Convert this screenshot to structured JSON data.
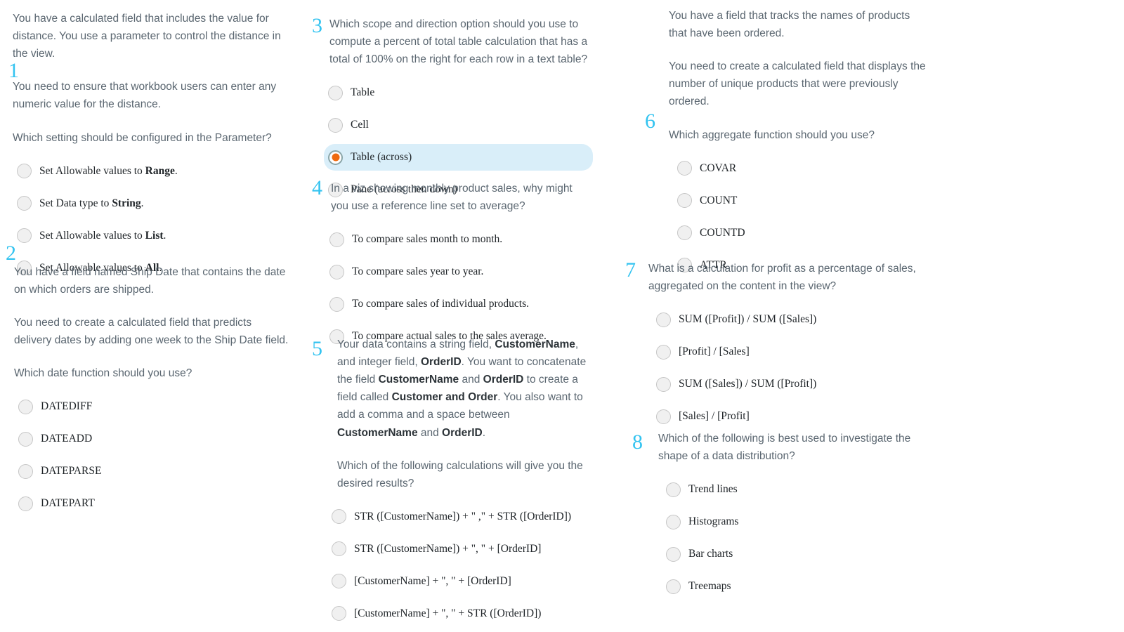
{
  "accent": {
    "number_color": "#33c3f0",
    "selected_row_bg": "#d9eef9",
    "selected_radio_dot": "#ef6a10",
    "stem_text": "#5a6670",
    "option_text": "#202529"
  },
  "questions": [
    {
      "number": "1",
      "stem_paragraphs": [
        "You have a calculated field that includes the value for distance. You use a parameter to control the distance in the view.",
        "You need to ensure that workbook users can enter any numeric value for the distance.",
        "Which setting should be configured in the Parameter?"
      ],
      "options": [
        {
          "prefix": "Set Allowable values to ",
          "bold": "Range",
          "suffix": "."
        },
        {
          "prefix": "Set Data type to ",
          "bold": "String",
          "suffix": "."
        },
        {
          "prefix": "Set Allowable values to ",
          "bold": "List",
          "suffix": "."
        },
        {
          "prefix": "Set Allowable values to ",
          "bold": "All",
          "suffix": "."
        }
      ],
      "selected_index": -1
    },
    {
      "number": "2",
      "stem_paragraphs": [
        "You have a field named Ship Date that contains the date on which orders are shipped.",
        "You need to create a calculated field that predicts delivery dates by adding one week to the Ship Date field.",
        "Which date function should you use?"
      ],
      "options": [
        {
          "prefix": "DATEDIFF",
          "bold": "",
          "suffix": ""
        },
        {
          "prefix": "DATEADD",
          "bold": "",
          "suffix": ""
        },
        {
          "prefix": "DATEPARSE",
          "bold": "",
          "suffix": ""
        },
        {
          "prefix": "DATEPART",
          "bold": "",
          "suffix": ""
        }
      ],
      "selected_index": -1
    },
    {
      "number": "3",
      "stem_paragraphs": [
        "Which scope and direction option should you use to compute a percent of total table calculation that has a total of 100% on the right for each row in a text table?"
      ],
      "options": [
        {
          "prefix": "Table",
          "bold": "",
          "suffix": ""
        },
        {
          "prefix": "Cell",
          "bold": "",
          "suffix": ""
        },
        {
          "prefix": "Table (across)",
          "bold": "",
          "suffix": ""
        },
        {
          "prefix": "Pane (across then down)",
          "bold": "",
          "suffix": ""
        }
      ],
      "selected_index": 2
    },
    {
      "number": "4",
      "stem_paragraphs": [
        "In a viz showing monthly product sales, why might you use a reference line set to average?"
      ],
      "options": [
        {
          "prefix": "To compare sales month to month.",
          "bold": "",
          "suffix": ""
        },
        {
          "prefix": "To compare sales year to year.",
          "bold": "",
          "suffix": ""
        },
        {
          "prefix": "To compare sales of individual products.",
          "bold": "",
          "suffix": ""
        },
        {
          "prefix": "To compare actual sales to the sales average.",
          "bold": "",
          "suffix": ""
        }
      ],
      "selected_index": -1
    },
    {
      "number": "5",
      "stem_paragraphs": [
        "Your data contains a string field, CustomerName, and integer field, OrderID. You want to concatenate the field CustomerName and OrderID to create a field called Customer and Order. You also want to add a comma and a space between CustomerName and OrderID.",
        "Which of the following calculations will give you the desired results?"
      ],
      "options": [
        {
          "prefix": "STR ([CustomerName]) + \" ,\" + STR ([OrderID])",
          "bold": "",
          "suffix": ""
        },
        {
          "prefix": "STR ([CustomerName]) + \", \" + [OrderID]",
          "bold": "",
          "suffix": ""
        },
        {
          "prefix": "[CustomerName] + \", \"  + [OrderID]",
          "bold": "",
          "suffix": ""
        },
        {
          "prefix": "[CustomerName] + \", \" + STR ([OrderID])",
          "bold": "",
          "suffix": ""
        }
      ],
      "selected_index": -1
    },
    {
      "number": "6",
      "stem_paragraphs": [
        "You have a field that tracks the names of products that have been ordered.",
        "You need to create a calculated field that displays the number of unique products that were previously ordered.",
        "Which aggregate function should you use?"
      ],
      "options": [
        {
          "prefix": "COVAR",
          "bold": "",
          "suffix": ""
        },
        {
          "prefix": "COUNT",
          "bold": "",
          "suffix": ""
        },
        {
          "prefix": "COUNTD",
          "bold": "",
          "suffix": ""
        },
        {
          "prefix": "ATTR",
          "bold": "",
          "suffix": ""
        }
      ],
      "selected_index": -1
    },
    {
      "number": "7",
      "stem_paragraphs": [
        "What is a calculation for profit as a percentage of sales, aggregated on the content in the view?"
      ],
      "options": [
        {
          "prefix": "SUM ([Profit]) / SUM ([Sales])",
          "bold": "",
          "suffix": ""
        },
        {
          "prefix": "[Profit] / [Sales]",
          "bold": "",
          "suffix": ""
        },
        {
          "prefix": "SUM ([Sales]) / SUM ([Profit])",
          "bold": "",
          "suffix": ""
        },
        {
          "prefix": "[Sales] / [Profit]",
          "bold": "",
          "suffix": ""
        }
      ],
      "selected_index": -1
    },
    {
      "number": "8",
      "stem_paragraphs": [
        "Which of the following is best used to investigate the shape of a data distribution?"
      ],
      "options": [
        {
          "prefix": "Trend lines",
          "bold": "",
          "suffix": ""
        },
        {
          "prefix": "Histograms",
          "bold": "",
          "suffix": ""
        },
        {
          "prefix": "Bar charts",
          "bold": "",
          "suffix": ""
        },
        {
          "prefix": "Treemaps",
          "bold": "",
          "suffix": ""
        }
      ],
      "selected_index": -1
    }
  ],
  "q5_rich_stem": {
    "line1_a": "Your data contains a string field, ",
    "line1_b": "CustomerName",
    "line1_c": ", and",
    "line2_a": "integer field, ",
    "line2_b": "OrderID",
    "line2_c": ". You want to concatenate the field",
    "line3_a": "CustomerName",
    "line3_b": " and ",
    "line3_c": "OrderID",
    "line3_d": " to create a field called",
    "line4_a": "Customer and Order",
    "line4_b": ". You also want to add a comma and",
    "line5_a": "a space between ",
    "line5_b": "CustomerName",
    "line5_c": " and ",
    "line5_d": "OrderID",
    "line5_e": ".",
    "para2": "Which of the following calculations will give you the desired results?"
  }
}
